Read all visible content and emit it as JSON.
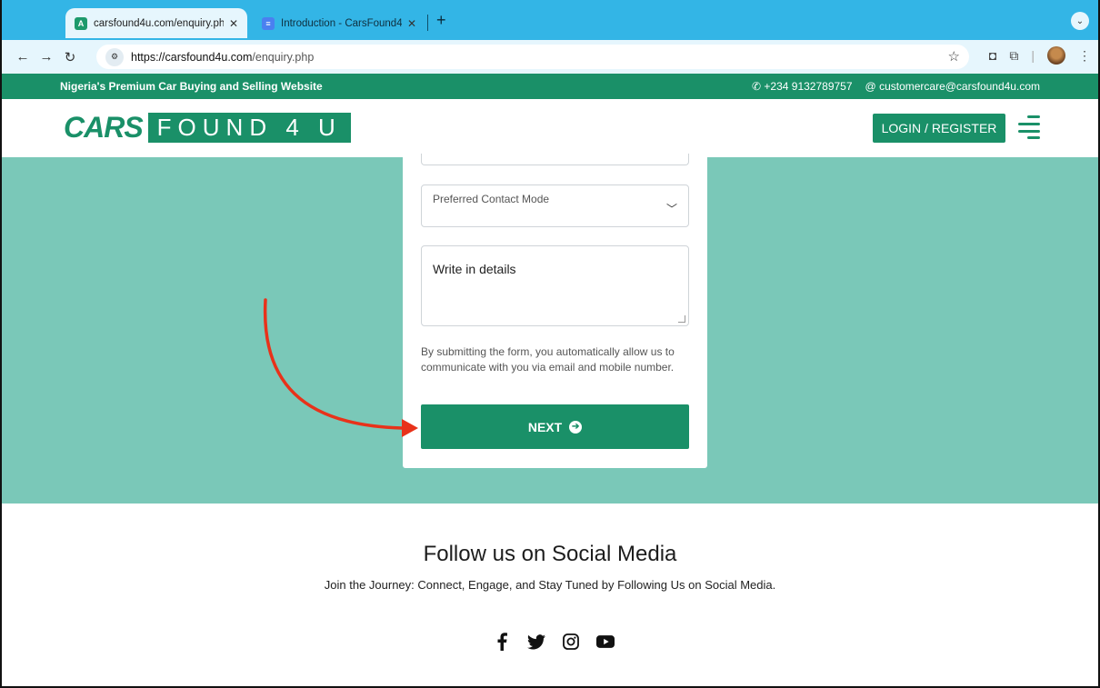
{
  "browser": {
    "tabs": [
      {
        "title": "carsfound4u.com/enquiry.php",
        "favicon": "site-a-icon",
        "active": true
      },
      {
        "title": "Introduction - CarsFound4U",
        "favicon": "docs-icon",
        "active": false
      }
    ],
    "url_host": "https://carsfound4u.com",
    "url_path": "/enquiry.php"
  },
  "topstrip": {
    "tagline": "Nigeria's Premium Car Buying and Selling Website",
    "phone": "+234 9132789757",
    "email": "customercare@carsfound4u.com"
  },
  "header": {
    "logo_cars": "CARS",
    "logo_found": "FOUND 4 U",
    "login_label": "LOGIN / REGISTER"
  },
  "form": {
    "contact_mode_label": "Preferred Contact Mode",
    "details_placeholder": "Write in details",
    "disclaimer": "By submitting the form, you automatically allow us to communicate with you via email and mobile number.",
    "next_label": "NEXT"
  },
  "social": {
    "title": "Follow us on Social Media",
    "subtitle": "Join the Journey: Connect, Engage, and Stay Tuned by Following Us on Social Media.",
    "icons": [
      "facebook-icon",
      "twitter-icon",
      "instagram-icon",
      "youtube-icon"
    ]
  },
  "colors": {
    "brand": "#1a9068",
    "hero_bg": "#7ac8b8",
    "chrome_tab": "#33b5e6",
    "annotation_arrow": "#e8321a"
  }
}
